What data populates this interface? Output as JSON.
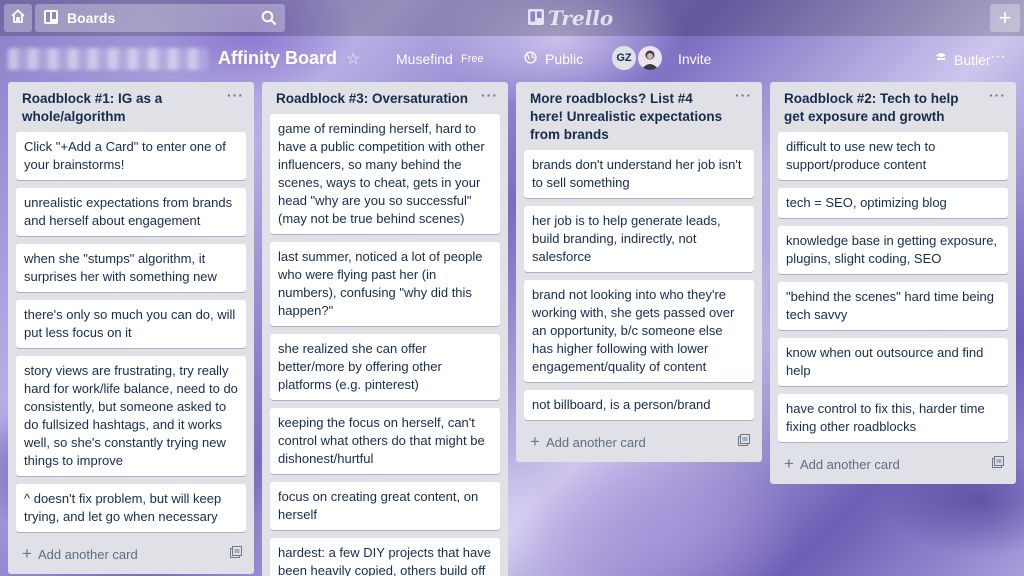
{
  "topbar": {
    "boards_label": "Boards",
    "logo_text": "Trello",
    "icons": [
      "home-icon",
      "boards-icon",
      "search-icon",
      "plus-icon"
    ]
  },
  "board": {
    "title": "Affinity Board",
    "team": "Musefind",
    "plan": "Free",
    "visibility": "Public",
    "member_initials": "GZ",
    "invite_label": "Invite",
    "butler_label": "Butler",
    "more": "···"
  },
  "lists": [
    {
      "title": "Roadblock #1: IG as a whole/algorithm",
      "cards": [
        "Click \"+Add a Card\" to enter one of your brainstorms!",
        "unrealistic expectations from brands and herself about engagement",
        "when she \"stumps\" algorithm, it surprises her with something new",
        "there's only so much you can do, will put less focus on it",
        "story views are frustrating, try really hard for work/life balance, need to do consistently, but someone asked to do fullsized hashtags, and it works well, so she's constantly trying new things to improve",
        "^ doesn't fix problem, but will keep trying, and let go when necessary"
      ],
      "add_label": "Add another card"
    },
    {
      "title": "Roadblock #3: Oversaturation",
      "cards": [
        "game of reminding herself, hard to have a public competition with other influencers, so many behind the scenes, ways to cheat, gets in your head \"why are you so successful\" (may not be true behind scenes)",
        "last summer, noticed a lot of people who were flying past her (in numbers), confusing \"why did this happen?\"",
        "she realized she can offer better/more by offering other platforms (e.g. pinterest)",
        "keeping the focus on herself, can't control what others do that might be dishonest/hurtful",
        "focus on creating great content, on herself",
        "hardest: a few DIY projects that have been heavily copied, others build off"
      ],
      "add_label": ""
    },
    {
      "title": "More roadblocks? List #4 here! Unrealistic expectations from brands",
      "cards": [
        "brands don't understand her job isn't to sell something",
        "her job is to help generate leads, build branding, indirectly, not salesforce",
        "brand not looking into who they're working with, she gets passed over an opportunity, b/c someone else has higher following with lower engagement/quality of content",
        "not billboard, is a person/brand"
      ],
      "add_label": "Add another card"
    },
    {
      "title": "Roadblock #2: Tech to help get exposure and growth",
      "cards": [
        "difficult to use new tech to support/produce content",
        "tech = SEO, optimizing blog",
        "knowledge base in getting exposure, plugins, slight coding, SEO",
        "\"behind the scenes\" hard time being tech savvy",
        "know when out outsource and find help",
        "have control to fix this, harder time fixing other roadblocks"
      ],
      "add_label": "Add another card"
    }
  ],
  "list_menu": "···",
  "add_plus": "+"
}
